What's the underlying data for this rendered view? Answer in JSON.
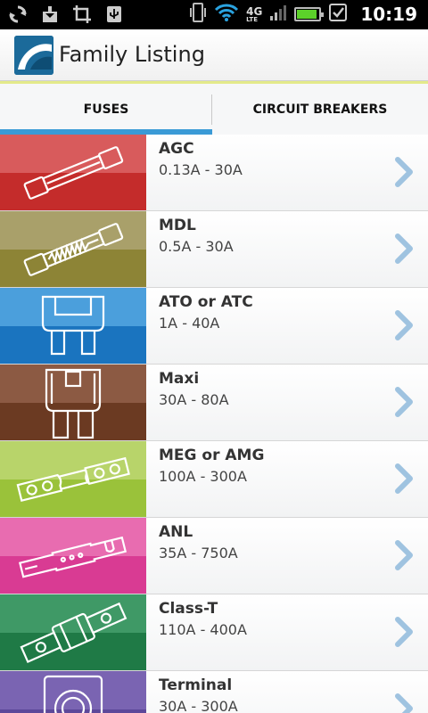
{
  "statusbar": {
    "time": "10:19",
    "network": "4G",
    "network_sub": "LTE",
    "battery_level": 0.9,
    "icons": [
      "sync-icon",
      "download-icon",
      "crop-icon",
      "usb-icon",
      "vibrate-icon",
      "wifi-icon",
      "signal-icon",
      "battery-icon",
      "checkbox-icon"
    ]
  },
  "app": {
    "title": "Family Listing"
  },
  "tabs": [
    {
      "label": "FUSES",
      "selected": true
    },
    {
      "label": "CIRCUIT BREAKERS",
      "selected": false
    }
  ],
  "colors": {
    "accent": "#3a9ad6",
    "tab_top": "#e3ea8a",
    "chevron": "#9fc3e0"
  },
  "items": [
    {
      "name": "AGC",
      "range": "0.13A - 30A",
      "color_top": "#d85b5c",
      "color_bottom": "#c42c2b",
      "icon": "glass-tube-fuse-icon"
    },
    {
      "name": "MDL",
      "range": "0.5A - 30A",
      "color_top": "#a9a06a",
      "color_bottom": "#8d8436",
      "icon": "slow-blow-fuse-icon"
    },
    {
      "name": "ATO or ATC",
      "range": "1A - 40A",
      "color_top": "#4b9fdc",
      "color_bottom": "#1a74bf",
      "icon": "blade-fuse-icon"
    },
    {
      "name": "Maxi",
      "range": "30A - 80A",
      "color_top": "#8c5a43",
      "color_bottom": "#6b3a22",
      "icon": "maxi-fuse-icon"
    },
    {
      "name": "MEG or AMG",
      "range": "100A - 300A",
      "color_top": "#b8d46a",
      "color_bottom": "#9ac23a",
      "icon": "bolt-down-fuse-icon"
    },
    {
      "name": "ANL",
      "range": "35A - 750A",
      "color_top": "#e86cb0",
      "color_bottom": "#d93b93",
      "icon": "anl-fuse-icon"
    },
    {
      "name": "Class-T",
      "range": "110A - 400A",
      "color_top": "#3f9966",
      "color_bottom": "#1f7a46",
      "icon": "class-t-fuse-icon"
    },
    {
      "name": "Terminal",
      "range": "30A - 300A",
      "color_top": "#7a64b2",
      "color_bottom": "#5d489a",
      "icon": "terminal-fuse-icon"
    }
  ]
}
